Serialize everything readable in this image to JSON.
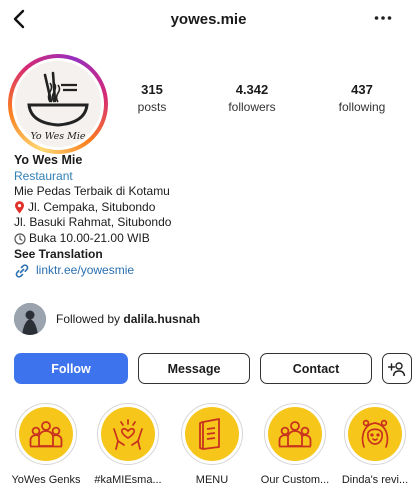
{
  "header": {
    "username": "yowes.mie",
    "back_icon": "back-chevron-icon",
    "more_icon": "more-dots-icon"
  },
  "profile": {
    "avatar_text": "Yo Wes Mie",
    "stats": [
      {
        "value": "315",
        "label": "posts"
      },
      {
        "value": "4.342",
        "label": "followers"
      },
      {
        "value": "437",
        "label": "following"
      }
    ]
  },
  "bio": {
    "name": "Yo Wes Mie",
    "category": "Restaurant",
    "tagline": "Mie Pedas Terbaik di Kotamu",
    "address1": "Jl. Cempaka, Situbondo",
    "address2": "Jl. Basuki Rahmat, Situbondo",
    "hours": "Buka 10.00-21.00 WIB",
    "see_translation": "See Translation",
    "link": "linktr.ee/yowesmie"
  },
  "followed_by": {
    "prefix": "Followed by",
    "user": "dalila.husnah"
  },
  "actions": {
    "follow": "Follow",
    "message": "Message",
    "contact": "Contact"
  },
  "highlights": [
    {
      "label": "YoWes Genks",
      "icon": "group-icon"
    },
    {
      "label": "#kaMIEsma...",
      "icon": "hands-heart-icon"
    },
    {
      "label": "MENU",
      "icon": "menu-book-icon"
    },
    {
      "label": "Our Custom...",
      "icon": "group-icon"
    },
    {
      "label": "Dinda's revi...",
      "icon": "girl-face-icon"
    }
  ],
  "colors": {
    "accent": "#3d73ec",
    "link": "#2a6fb0",
    "highlight_fill": "#f6c61a",
    "highlight_icon": "#c8321e"
  }
}
